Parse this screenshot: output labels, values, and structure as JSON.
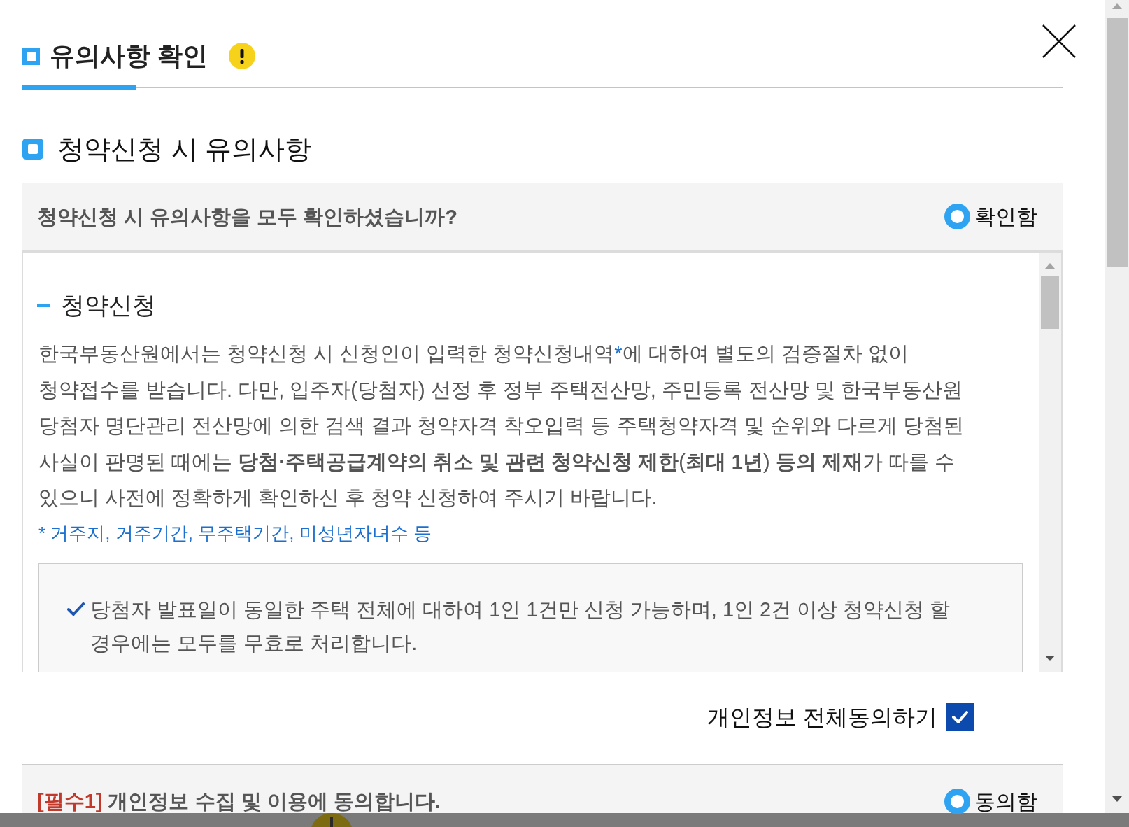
{
  "dialog": {
    "title": "유의사항 확인"
  },
  "section": {
    "title": "청약신청 시 유의사항"
  },
  "confirm_row": {
    "question": "청약신청 시 유의사항을 모두 확인하셨습니까?",
    "option": {
      "label": "확인함",
      "selected": true
    }
  },
  "notice": {
    "heading": "청약신청",
    "paragraph": [
      {
        "kind": "text",
        "text": "한국부동산원에서는 청약신청 시 신청인이 입력한 청약신청내역"
      },
      {
        "kind": "note_mark",
        "text": "*"
      },
      {
        "kind": "text",
        "text": "에 대하여 별도의 검증절차 없이 청약접수를 받습니다. 다만, 입주자(당첨자) 선정 후 정부 주택전산망, 주민등록 전산망 및 한국부동산원 당첨자 명단관리 전산망에 의한 검색 결과 청약자격 착오입력 등 주택청약자격 및 순위와 다르게 당첨된 사실이 판명된 때에는 **당첨·주택공급계약의 취소 및 관련 청약신청 제한**(**최대 1년**) **등의 제재**가 따를 수 있으니 사전에 정확하게 확인하신 후 청약 신청하여 주시기 바랍니다."
      }
    ],
    "footnote": "* 거주지, 거주기간, 무주택기간, 미성년자녀수 등",
    "rules": [
      {
        "text": "당첨자 발표일이 동일한 주택 전체에 대하여 1인 1건만 신청 가능하며, 1인 2건 이상 청약신청 할 경우에는 모두를 무효로 처리합니다."
      }
    ]
  },
  "agree_all": {
    "label": "개인정보 전체동의하기",
    "checked": true
  },
  "consents": [
    {
      "tag": "[필수1]",
      "text": "개인정보 수집 및 이용에 동의합니다.",
      "option": {
        "label": "동의함",
        "selected": true
      }
    }
  ]
}
